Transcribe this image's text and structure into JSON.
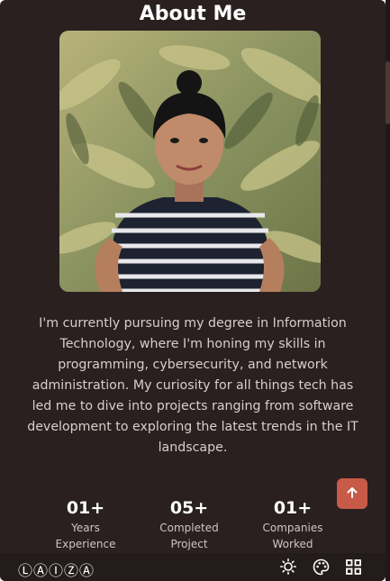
{
  "section": {
    "title": "About Me"
  },
  "bio": {
    "text": "I'm currently pursuing my degree in Information Technology, where I'm honing my skills in programming, cybersecurity, and network administration. My curiosity for all things tech has led me to dive into projects ranging from software development to exploring the latest trends in the IT landscape."
  },
  "stats": [
    {
      "value": "01+",
      "label_line1": "Years",
      "label_line2": "Experience"
    },
    {
      "value": "05+",
      "label_line1": "Completed",
      "label_line2": "Project"
    },
    {
      "value": "01+",
      "label_line1": "Companies",
      "label_line2": "Worked"
    }
  ],
  "footer": {
    "logo": "ⓁⒶⒾⓏⒶ"
  },
  "icons": {
    "scroll_top": "arrow-up-icon",
    "theme": "sun-icon",
    "palette": "palette-icon",
    "grid": "grid-icon"
  },
  "colors": {
    "background": "#2a2020",
    "accent": "#c75b48",
    "text": "#d8cfcb"
  }
}
